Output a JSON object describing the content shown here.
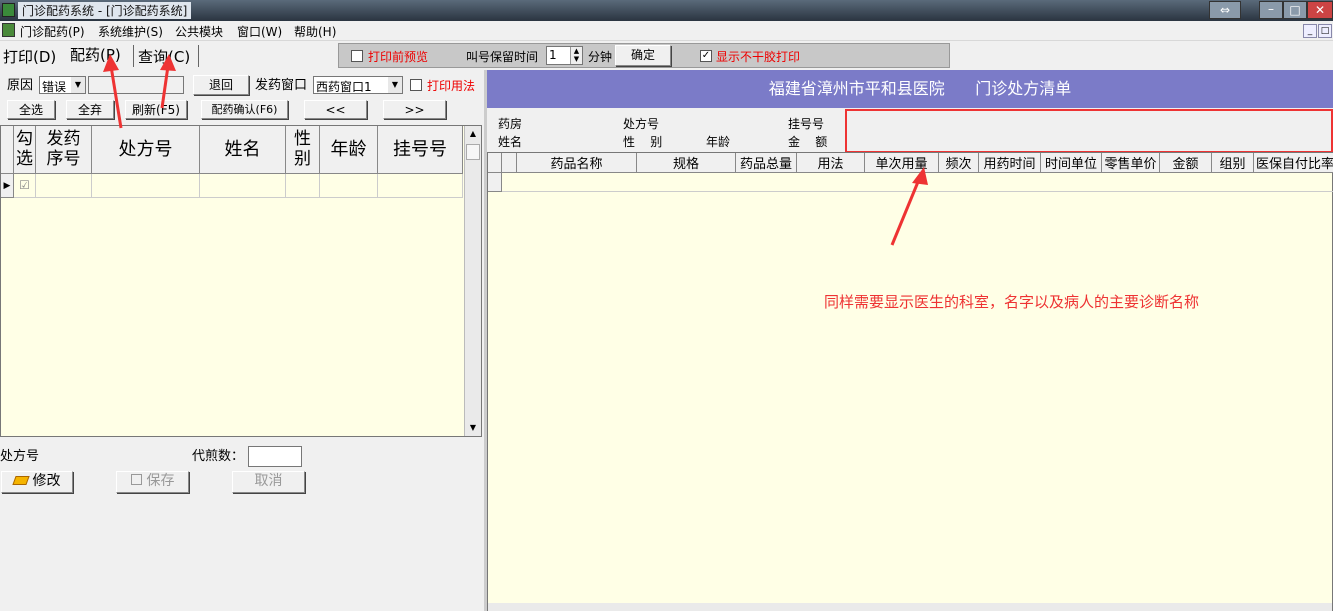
{
  "window": {
    "title": "门诊配药系统 - [门诊配药系统]"
  },
  "menu": [
    "门诊配药(P)",
    "系统维护(S)",
    "公共模块",
    "窗口(W)",
    "帮助(H)"
  ],
  "tabs": [
    "打印(D)",
    "配药(P)",
    "查询(C)"
  ],
  "toolbar": {
    "print_preview": "打印前预览",
    "call_label": "叫号保留时间",
    "call_value": "1",
    "minute": "分钟",
    "confirm": "确定",
    "show_nodry": "显示不干胶打印"
  },
  "left": {
    "reason_label": "原因",
    "reason_value": "错误",
    "return_btn": "退回",
    "window_label": "发药窗口",
    "window_value": "西药窗口1",
    "print_usage": "打印用法",
    "select_all": "全选",
    "discard_all": "全弃",
    "refresh": "刷新(F5)",
    "dispense_confirm": "配药确认(F6)",
    "prev": "<<",
    "next": ">>",
    "columns": [
      "勾选",
      "发药序号",
      "处方号",
      "姓名",
      "性别",
      "年龄",
      "挂号号"
    ],
    "row_check": "☑",
    "rx_label": "处方号",
    "decoct_label": "代煎数：",
    "modify": "修改",
    "save": "保存",
    "cancel": "取消"
  },
  "right": {
    "header_title": "福建省漳州市平和县医院      门诊处方清单",
    "info": [
      "药房",
      "处方号",
      "挂号号",
      "姓名",
      "性    别",
      "年龄",
      "金    额"
    ],
    "columns": [
      "药品名称",
      "规格",
      "药品总量",
      "用法",
      "单次用量",
      "频次",
      "用药时间",
      "时间单位",
      "零售单价",
      "金额",
      "组别",
      "医保自付比率"
    ]
  },
  "annotation": "同样需要显示医生的科室，名字以及病人的主要诊断名称",
  "colors": {
    "header": "#7b7bc8",
    "cream": "#ffffe6",
    "annotation": "#e33"
  }
}
